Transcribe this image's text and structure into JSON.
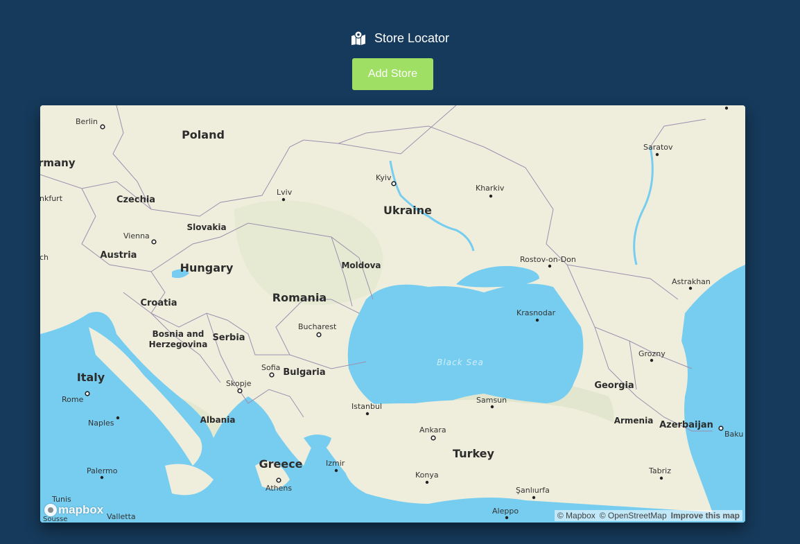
{
  "header": {
    "title": "Store Locator",
    "icon": "map-icon"
  },
  "actions": {
    "add_store_label": "Add Store"
  },
  "colors": {
    "background": "#163a5b",
    "button": "#9fdf63",
    "land": "#efeedd",
    "water": "#76cdf0"
  },
  "map": {
    "countries": [
      "Poland",
      "Germany",
      "Czechia",
      "Slovakia",
      "Austria",
      "Hungary",
      "Ukraine",
      "Moldova",
      "Romania",
      "Croatia",
      "Bosnia and",
      "Herzegovina",
      "Serbia",
      "Bulgaria",
      "Italy",
      "Albania",
      "Greece",
      "Turkey",
      "Georgia",
      "Armenia",
      "Azerbaijan"
    ],
    "germany_partial": "rmany",
    "cities": [
      "Berlin",
      "Lviv",
      "Kyiv",
      "Kharkiv",
      "Saratov",
      "Vienna",
      "Rostov-on-Don",
      "Astrakhan",
      "Krasnodar",
      "Bucharest",
      "Grozny",
      "Sofia",
      "Skopje",
      "Rome",
      "Istanbul",
      "Samsun",
      "Naples",
      "Ankara",
      "Izmir",
      "Palermo",
      "Athens",
      "Konya",
      "Tabriz",
      "Tunis",
      "Valletta",
      "Sousse",
      "Şanlıurfa",
      "Aleppo",
      "Baku",
      "nkfurt",
      "ch"
    ],
    "water_label": "Black Sea"
  },
  "attribution": {
    "mapbox": "© Mapbox",
    "osm": "© OpenStreetMap",
    "improve": "Improve this map"
  },
  "logo": {
    "text": "mapbox"
  }
}
